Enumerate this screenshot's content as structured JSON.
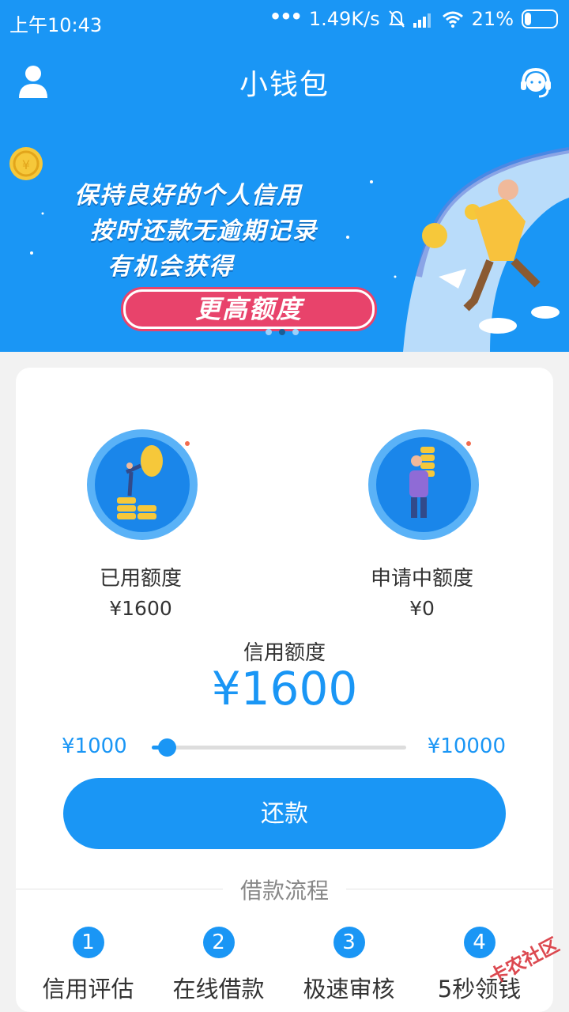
{
  "status_bar": {
    "time": "上午10:43",
    "dots": "•••",
    "speed": "1.49K/s",
    "battery": "21%"
  },
  "header": {
    "title": "小钱包",
    "user_icon": "user-icon",
    "support_icon": "headset-icon"
  },
  "banner": {
    "line1": "保持良好的个人信用",
    "line2": "按时还款无逾期记录",
    "line3": "有机会获得",
    "cta": "更高额度",
    "pages": 3,
    "active_page": 2
  },
  "credit": {
    "used_label": "已用额度",
    "used_value": "¥1600",
    "applying_label": "申请中额度",
    "applying_value": "¥0",
    "title": "信用额度",
    "amount": "¥1600",
    "range_min": "¥1000",
    "range_max": "¥10000",
    "slider_fraction": 0.06
  },
  "repay_button": "还款",
  "process": {
    "title": "借款流程",
    "steps": [
      {
        "num": "1",
        "label": "信用评估"
      },
      {
        "num": "2",
        "label": "在线借款"
      },
      {
        "num": "3",
        "label": "极速审核"
      },
      {
        "num": "4",
        "label": "5秒领钱"
      }
    ]
  },
  "colors": {
    "primary": "#1a96f5",
    "cta": "#e8436b"
  },
  "watermark": "卡农社区"
}
